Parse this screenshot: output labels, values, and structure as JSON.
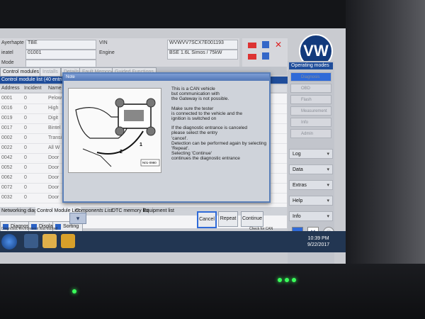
{
  "vehicle": {
    "labels": [
      "Ayerhapte",
      "ieatel",
      "Mode"
    ],
    "values": [
      "TBE",
      "01001",
      ""
    ],
    "vin_label": "VIN",
    "vin": "WVWVV7SCX7E001193",
    "engine_label": "Engine",
    "engine": "BSE 1.6L Simos / 75kW"
  },
  "top_tabs": [
    "Control modules",
    "Installs",
    "Details",
    "Fault Memory",
    "Guided Functions"
  ],
  "list_title": "Control module list (40 entries)",
  "columns": [
    "Address",
    "Incident",
    "Name"
  ],
  "rows": [
    {
      "addr": "0001",
      "inc": "0",
      "name": "Pelow"
    },
    {
      "addr": "0016",
      "inc": "0",
      "name": "High"
    },
    {
      "addr": "0019",
      "inc": "0",
      "name": "Digit"
    },
    {
      "addr": "0017",
      "inc": "0",
      "name": "Bintel"
    },
    {
      "addr": "0002",
      "inc": "0",
      "name": "Transi"
    },
    {
      "addr": "0022",
      "inc": "0",
      "name": "All W"
    },
    {
      "addr": "0042",
      "inc": "0",
      "name": "Door"
    },
    {
      "addr": "0052",
      "inc": "0",
      "name": "Door"
    },
    {
      "addr": "0062",
      "inc": "0",
      "name": "Door"
    },
    {
      "addr": "0072",
      "inc": "0",
      "name": "Door"
    },
    {
      "addr": "0032",
      "inc": "0",
      "name": "Door"
    }
  ],
  "bottom_tabs": [
    "Networking diagram",
    "Control Module List",
    "Components List",
    "DTC memory list",
    "Equipment list"
  ],
  "actions": {
    "diagnosis": "Diagnosis",
    "display": "Display",
    "sorting": "Sorting"
  },
  "status_line": "Diagnostic environment was started",
  "status_right": "Check for CAN diagnosis",
  "operating_modes": {
    "title": "Operating modes",
    "items": [
      "Diagnosis",
      "OBD",
      "Flash",
      "Measurement",
      "Info",
      "Admin"
    ]
  },
  "side_menu": [
    "Log",
    "Data",
    "Extras",
    "Help",
    "Info"
  ],
  "dialog": {
    "title": "Note",
    "illus_label": "N01-0980",
    "callouts": [
      "1",
      "2"
    ],
    "message": [
      "This is a CAN vehicle",
      "but communication with",
      "the Gateway is not possible.",
      "",
      "Make sure the tester",
      "is connected to the vehicle and the",
      "ignition is switched on",
      "",
      "If the diagnostic entrance is canceled",
      "please select the entry",
      "'cancel'.",
      "Detection can be performed again by selecting",
      "'Repeat'.",
      "Selecting 'Continue'",
      "continues the diagnostic entrance"
    ],
    "buttons": {
      "cancel": "Cancel",
      "repeat": "Repeat",
      "continue": "Continue"
    }
  },
  "clock": {
    "time": "10:39 PM",
    "date": "9/22/2017"
  },
  "colors": {
    "accent": "#2f6ad8",
    "header": "#1f4d9a",
    "taskbar": "#223652",
    "led": "#39ff5a"
  }
}
